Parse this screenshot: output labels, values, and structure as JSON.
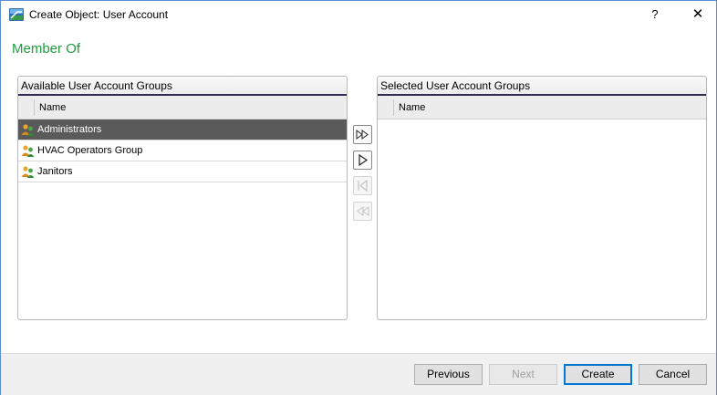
{
  "window": {
    "title": "Create Object: User Account",
    "help_label": "?",
    "close_label": "✕"
  },
  "section_title": "Member Of",
  "available": {
    "header": "Available User Account Groups",
    "column_name": "Name",
    "rows": [
      {
        "label": "Administrators",
        "selected": true
      },
      {
        "label": "HVAC Operators Group",
        "selected": false
      },
      {
        "label": "Janitors",
        "selected": false
      }
    ]
  },
  "selected_groups": {
    "header": "Selected User Account Groups",
    "column_name": "Name",
    "rows": []
  },
  "transfer_buttons": [
    {
      "name": "add-all",
      "icon": "double-chevron-right-icon",
      "enabled": true
    },
    {
      "name": "add-selected",
      "icon": "triangle-right-icon",
      "enabled": true
    },
    {
      "name": "remove-selected",
      "icon": "bar-triangle-left-icon",
      "enabled": false
    },
    {
      "name": "remove-all",
      "icon": "double-chevron-left-icon",
      "enabled": false
    }
  ],
  "footer": {
    "previous_label": "Previous",
    "next_label": "Next",
    "create_label": "Create",
    "cancel_label": "Cancel"
  },
  "colors": {
    "section_title": "#1f9b3c",
    "selected_row": "#5a5a5a",
    "header_underline": "#2d2d55",
    "default_button_border": "#0078d7"
  }
}
